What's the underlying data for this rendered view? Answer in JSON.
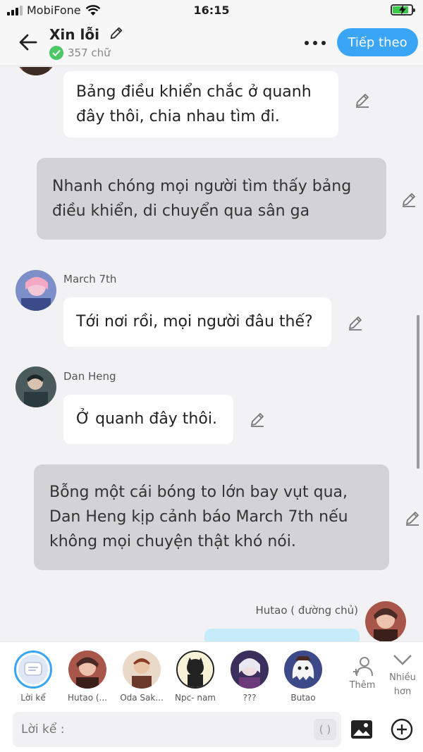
{
  "status_bar": {
    "carrier": "MobiFone",
    "time": "16:15"
  },
  "header": {
    "title": "Xin lỗi",
    "word_count": "357 chữ",
    "next_label": "Tiếp theo"
  },
  "messages": [
    {
      "type": "character",
      "text_lines": [
        "Bảng điều khiển chắc ở quanh",
        "đây thôi, chia nhau tìm đi."
      ]
    },
    {
      "type": "narration",
      "text_lines": [
        "Nhanh chóng mọi người tìm thấy bảng",
        "điều khiển, di chuyển qua sân ga"
      ]
    },
    {
      "type": "character",
      "speaker": "March 7th",
      "text_lines": [
        "Tới nơi rồi, mọi người đâu thế?"
      ]
    },
    {
      "type": "character",
      "speaker": "Dan Heng",
      "text_lines": [
        "Ở quanh đây thôi."
      ]
    },
    {
      "type": "narration",
      "text_lines": [
        "Bỗng một cái bóng to lớn bay vụt qua,",
        "Dan Heng kịp cảnh báo March 7th  nếu",
        "không mọi chuyện thật khó nói."
      ]
    },
    {
      "type": "character",
      "speaker": "Hutao ( đường chủ)",
      "text_lines": []
    }
  ],
  "characters": [
    {
      "label": "Lời kể"
    },
    {
      "label": "Hutao (..."
    },
    {
      "label": "Oda Sak..."
    },
    {
      "label": "Npc- nam"
    },
    {
      "label": "???"
    },
    {
      "label": "Butao"
    }
  ],
  "add_character_label": "Thêm",
  "more_label_1": "Nhiều",
  "more_label_2": "hơn",
  "input": {
    "placeholder": "Lời kể :",
    "paren_label": "( )"
  },
  "colors": {
    "accent": "#3aa5f5",
    "narration_bg": "#d3d3d5",
    "check_green": "#4cc766"
  }
}
